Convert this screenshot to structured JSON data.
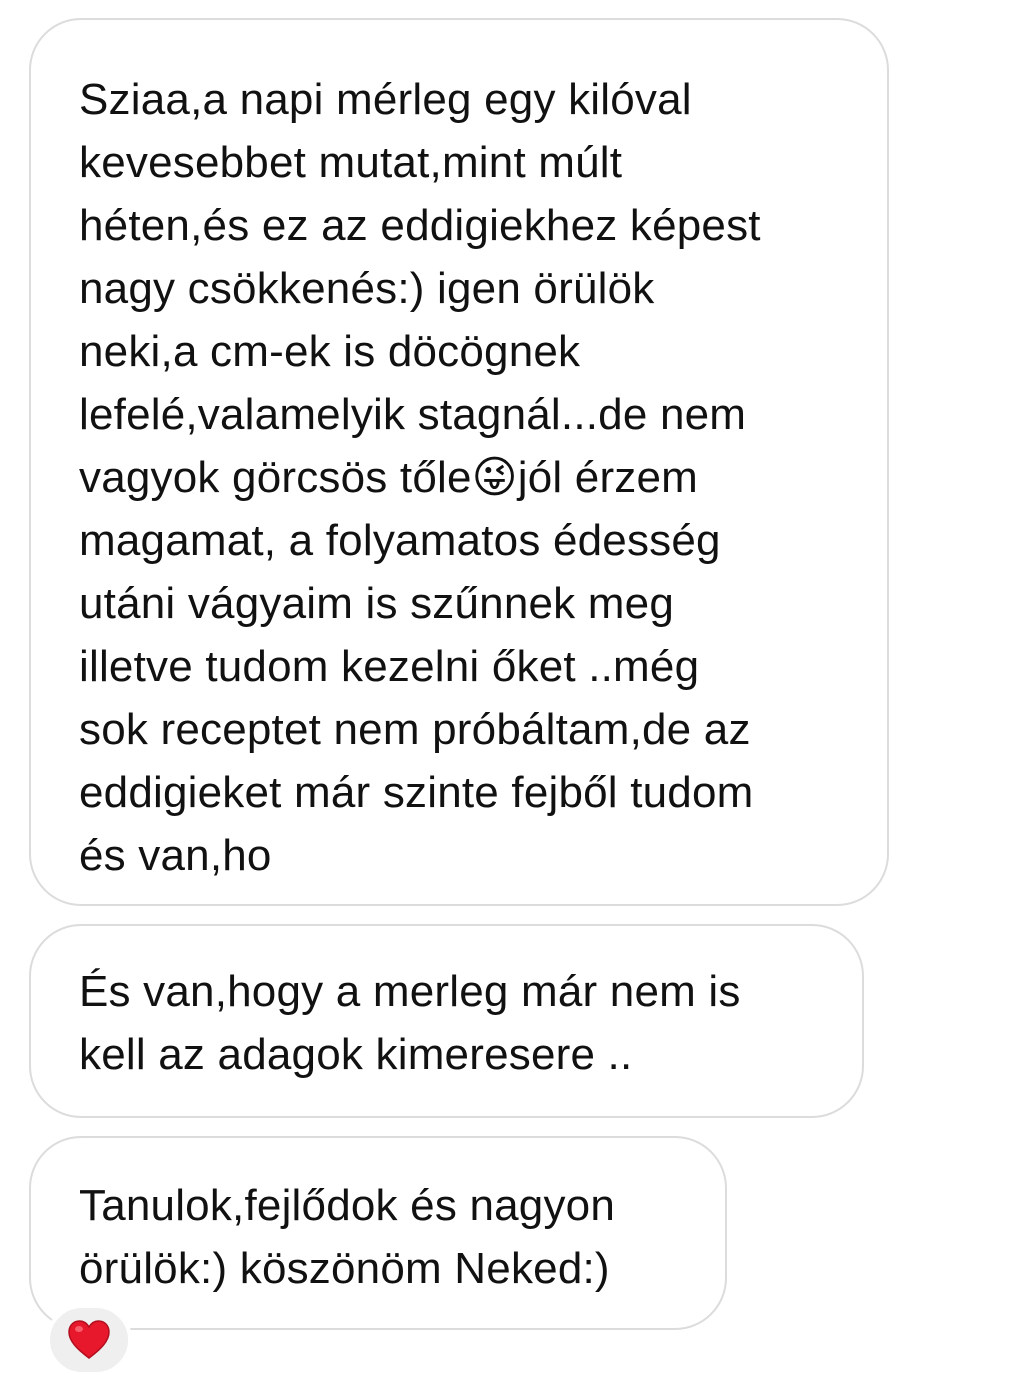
{
  "messages": [
    {
      "text": "Sziaa,a napi mérleg egy kilóval\nkevesebbet mutat,mint múlt\nhéten,és ez az eddigiekhez képest\nnagy csökkenés:) igen örülök\nneki,a cm-ek is döcögnek\nlefelé,valamelyik stagnál...de nem\nvagyok görcsös tőle😜jól érzem\nmagamat, a folyamatos édesség\nutáni vágyaim is szűnnek meg\nilletve tudom kezelni őket ..még\nsok receptet nem próbáltam,de az\neddigieket már szinte fejből tudom\nés van,ho"
    },
    {
      "text": "És van,hogy  a merleg már nem is\nkell az adagok kimeresere .."
    },
    {
      "text": "Tanulok,fejlődok és nagyon\nörülök:) köszönöm Neked:)"
    }
  ],
  "reaction": {
    "icon": "red-heart-icon",
    "color": "#e8182c"
  }
}
